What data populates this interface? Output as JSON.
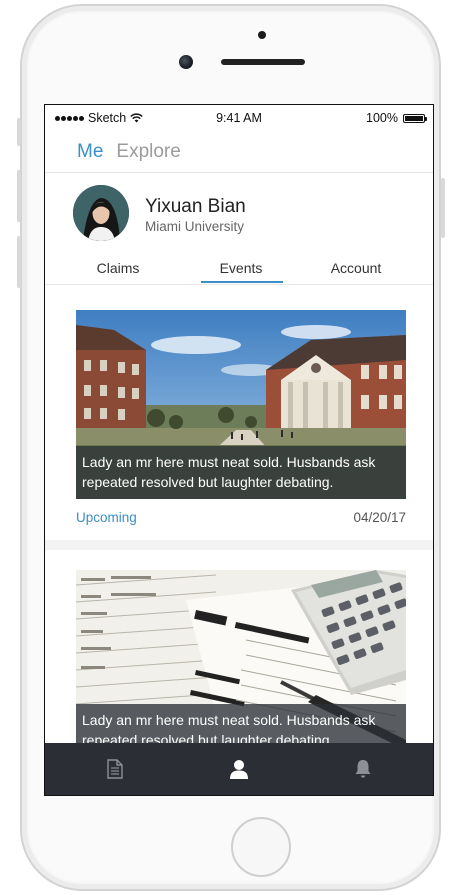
{
  "status_bar": {
    "carrier": "Sketch",
    "time": "9:41 AM",
    "battery": "100%"
  },
  "top_tabs": [
    {
      "label": "Me"
    },
    {
      "label": "Explore"
    }
  ],
  "profile": {
    "name": "Yixuan Bian",
    "school": "Miami University"
  },
  "sub_tabs": [
    {
      "label": "Claims"
    },
    {
      "label": "Events"
    },
    {
      "label": "Account"
    }
  ],
  "events": [
    {
      "caption": "Lady an mr here must neat sold. Husbands ask repeated resolved but laughter debating.",
      "status": "Upcoming",
      "date": "04/20/17"
    },
    {
      "caption": "Lady an mr here must neat sold. Husbands ask repeated resolved but laughter debating."
    }
  ],
  "bottom_nav": [
    {
      "icon": "document-icon"
    },
    {
      "icon": "user-icon"
    },
    {
      "icon": "bell-icon"
    }
  ],
  "colors": {
    "accent": "#3a8fc6",
    "bar": "#2b2e35"
  }
}
